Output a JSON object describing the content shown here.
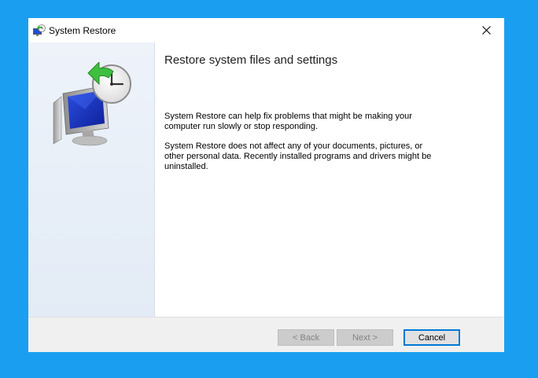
{
  "colors": {
    "desktop": "#1a9ff0",
    "focus_border": "#0078d7"
  },
  "window": {
    "title": "System Restore",
    "icon": "system-restore-icon",
    "close_icon": "close-icon"
  },
  "side": {
    "graphic": "system-restore-clock-monitor-icon"
  },
  "content": {
    "heading": "Restore system files and settings",
    "paragraph1": "System Restore can help fix problems that might be making your computer run slowly or stop responding.",
    "paragraph2": "System Restore does not affect any of your documents, pictures, or other personal data. Recently installed programs and drivers might be uninstalled."
  },
  "buttons": {
    "back": "< Back",
    "next": "Next >",
    "cancel": "Cancel"
  }
}
